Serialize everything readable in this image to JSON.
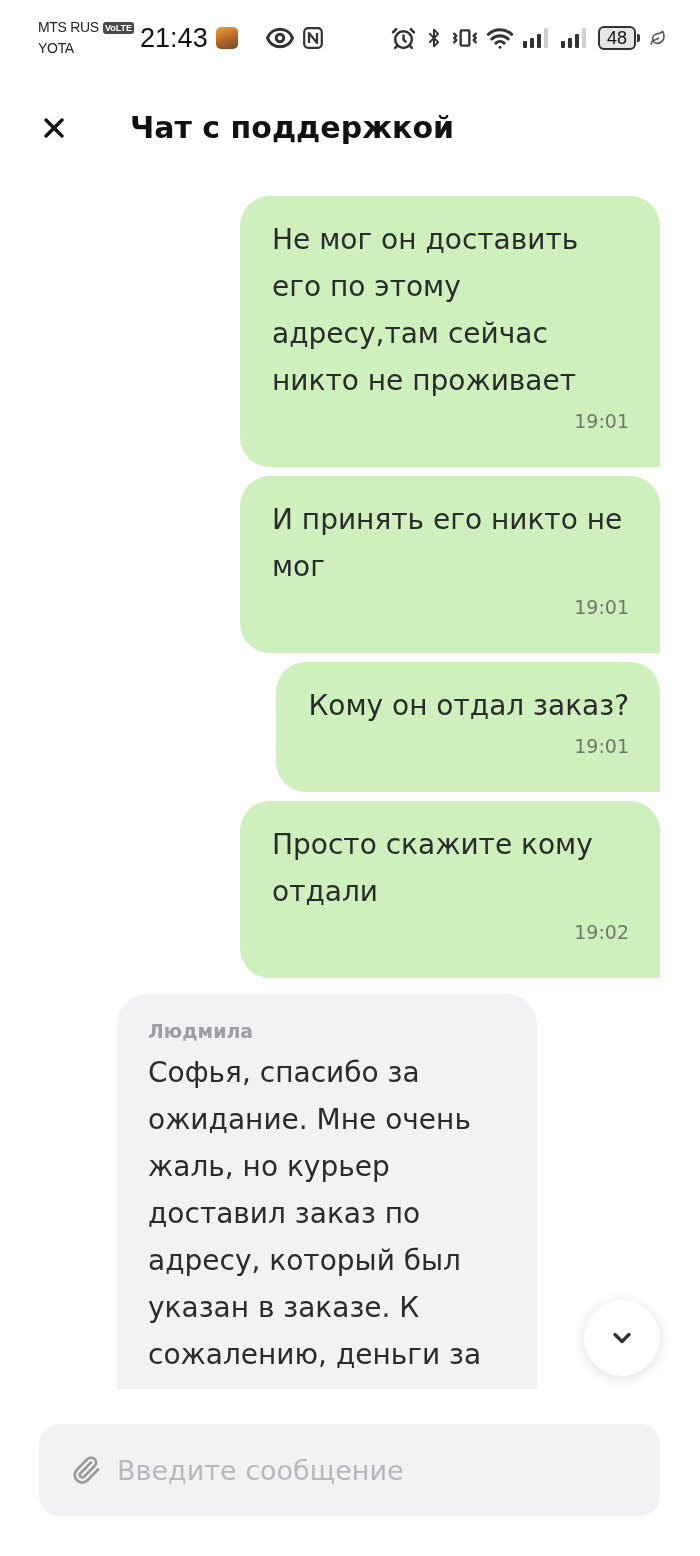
{
  "status_bar": {
    "carriers": [
      "MTS RUS",
      "YOTA"
    ],
    "network_badge": "VoLTE",
    "time": "21:43",
    "battery": "48"
  },
  "header": {
    "title": "Чат с поддержкой"
  },
  "messages": [
    {
      "kind": "outgoing",
      "text": "Не мог он доставить его по этому адресу,там сейчас никто не проживает",
      "time": "19:01"
    },
    {
      "kind": "outgoing",
      "text": "И принять его никто не мог",
      "time": "19:01"
    },
    {
      "kind": "outgoing",
      "text": "Кому он отдал заказ?",
      "time": "19:01"
    },
    {
      "kind": "outgoing",
      "text": "Просто скажите кому отдали",
      "time": "19:02"
    },
    {
      "kind": "incoming",
      "sender": "Людмила",
      "text": "Софья, спасибо за ожидание. Мне очень жаль, но курьер доставил заказ по адресу, который был указан в заказе. К сожалению, деньги за"
    }
  ],
  "composer": {
    "placeholder": "Введите сообщение"
  }
}
